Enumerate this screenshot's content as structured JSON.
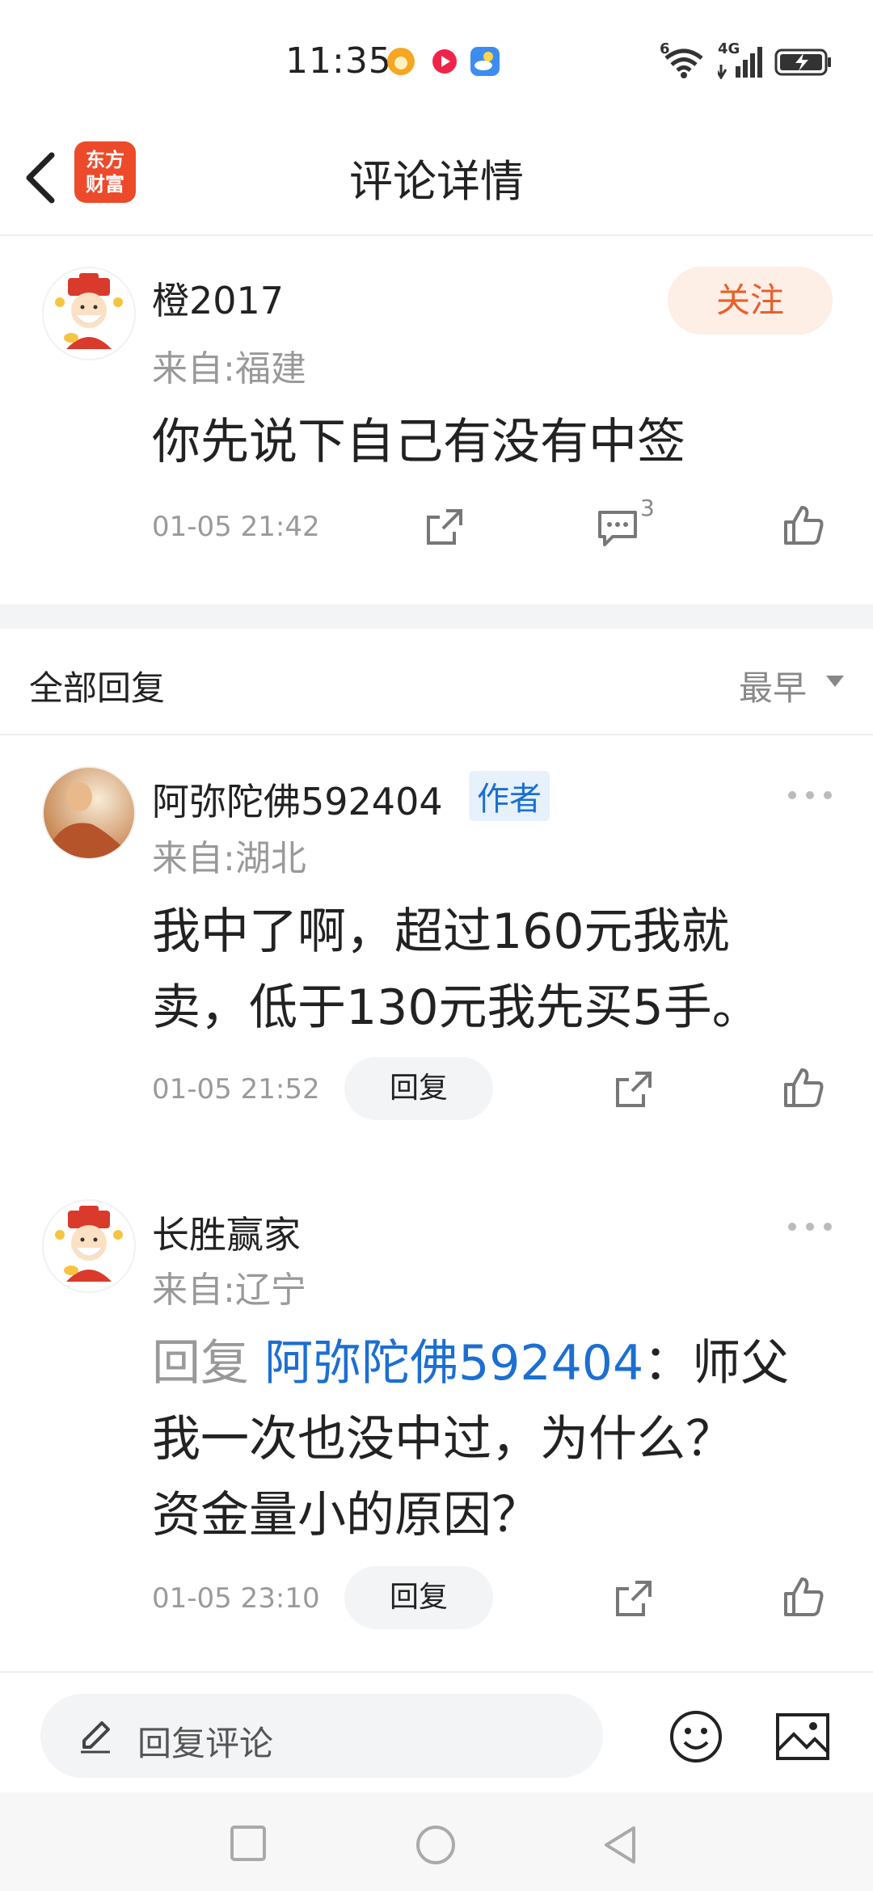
{
  "status_bar": {
    "time": "11:35",
    "left_icons": [
      "sun-app-icon",
      "red-app-icon",
      "weather-icon"
    ],
    "right_icons": [
      "wifi-6-icon",
      "4g-signal-icon",
      "battery-charging-icon"
    ],
    "wifi_tag": "6",
    "network_tag": "4G"
  },
  "header": {
    "title": "评论详情",
    "logo_line1": "东方",
    "logo_line2": "财富"
  },
  "main_comment": {
    "username": "橙2017",
    "location": "来自:福建",
    "follow_label": "关注",
    "content": "你先说下自己有没有中签",
    "time": "01-05 21:42",
    "comment_count": "3"
  },
  "replies_header": {
    "title": "全部回复",
    "sort": "最早"
  },
  "replies": [
    {
      "username": "阿弥陀佛592404",
      "badge": "作者",
      "location": "来自:湖北",
      "content_line1": "我中了啊，超过160元我就",
      "content_line2": "卖，低于130元我先买5手。",
      "time": "01-05 21:52",
      "reply_label": "回复"
    },
    {
      "username": "长胜赢家",
      "location": "来自:辽宁",
      "prefix": "回复",
      "mention": "阿弥陀佛592404",
      "after_mention": "：师父",
      "content_line2": "我一次也没中过，为什么？",
      "content_line3": "资金量小的原因？",
      "time": "01-05 23:10",
      "reply_label": "回复"
    }
  ],
  "bottom_bar": {
    "placeholder": "回复评论"
  },
  "colors": {
    "accent_orange": "#e8602a",
    "link_blue": "#1c6fd1",
    "logo_red": "#ec4a2a"
  }
}
